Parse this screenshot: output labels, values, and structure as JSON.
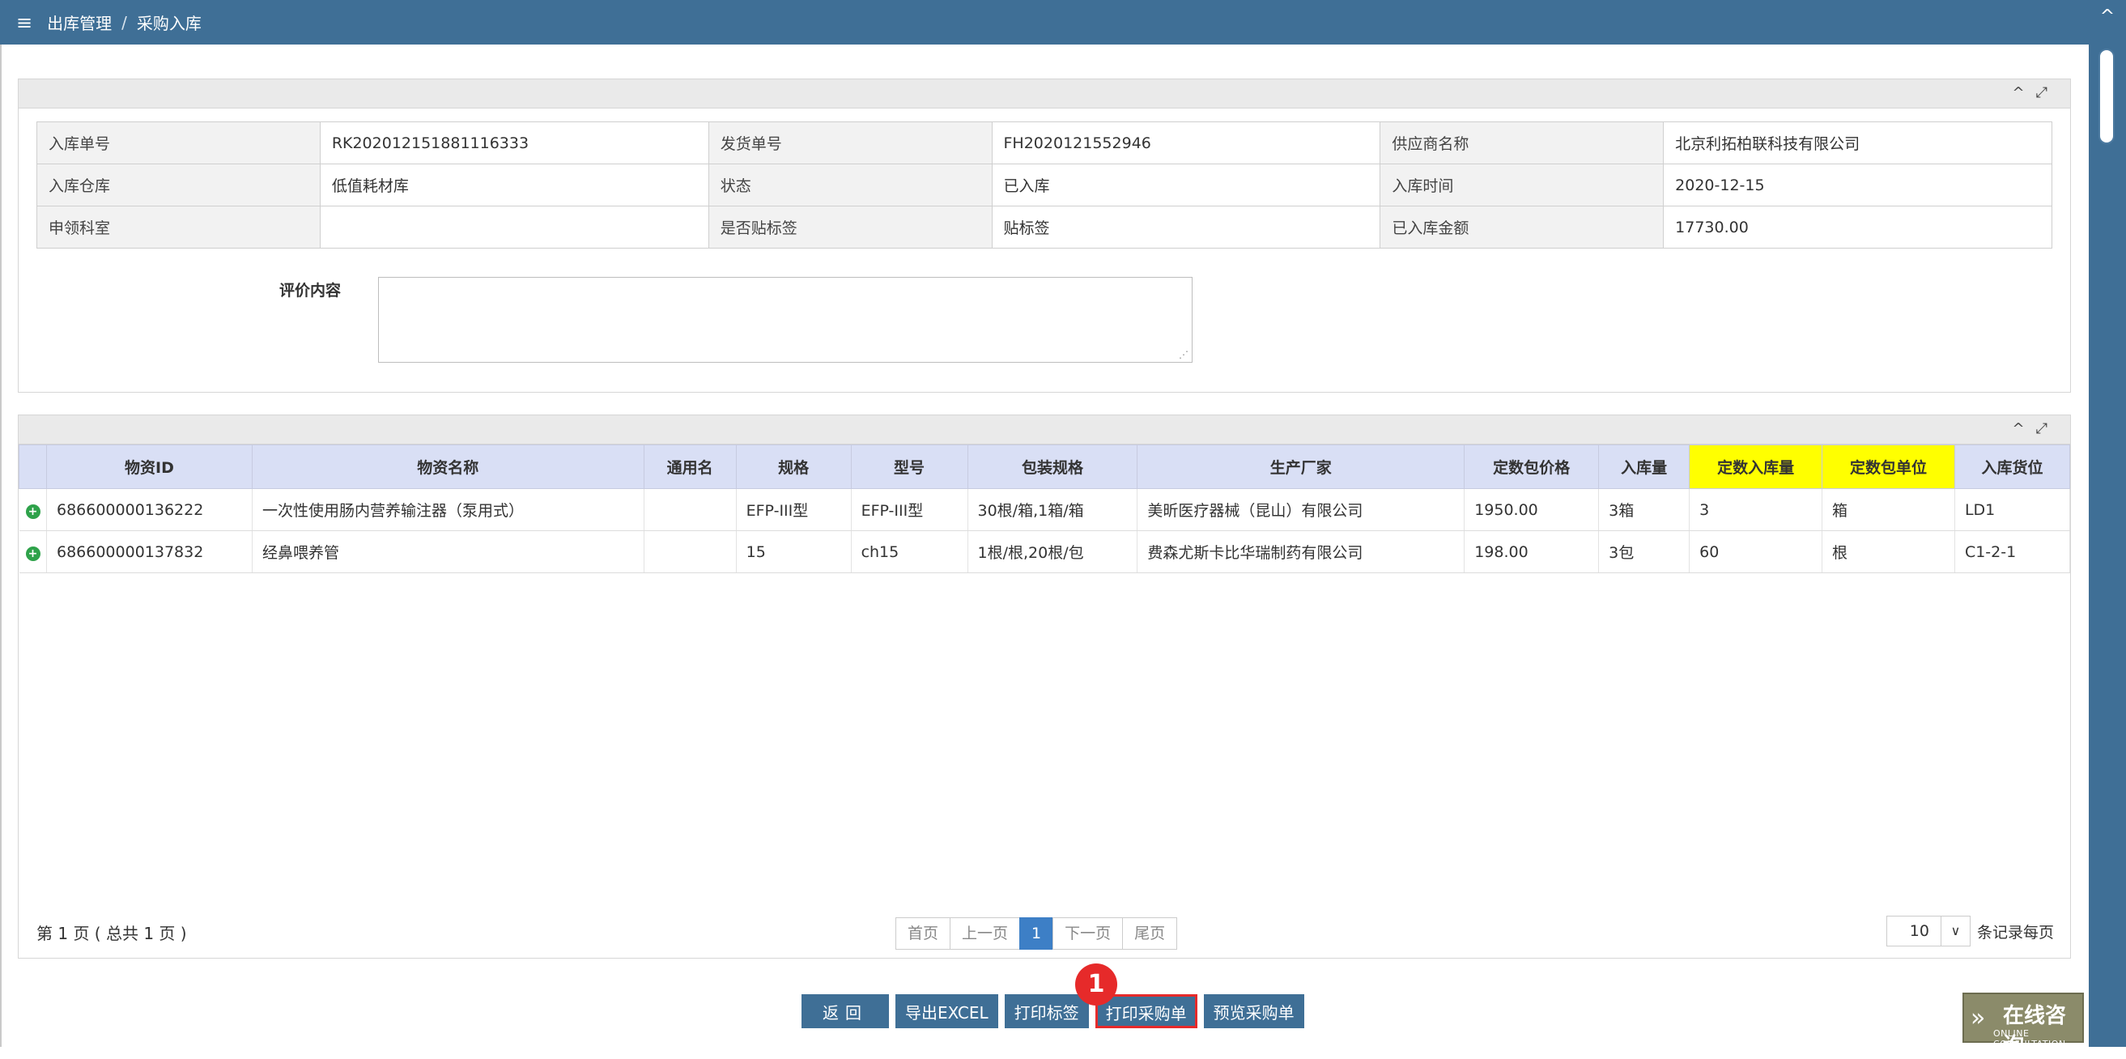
{
  "topbar": {
    "menu_icon": "≡",
    "breadcrumb_parent": "出库管理",
    "breadcrumb_sep": "/",
    "breadcrumb_current": "采购入库"
  },
  "panel_tools": {
    "collapse": "^",
    "expand": "⤢"
  },
  "info": {
    "rows": [
      [
        {
          "label": "入库单号",
          "value": "RK202012151881116333"
        },
        {
          "label": "发货单号",
          "value": "FH2020121552946"
        },
        {
          "label": "供应商名称",
          "value": "北京利拓柏联科技有限公司"
        }
      ],
      [
        {
          "label": "入库仓库",
          "value": "低值耗材库"
        },
        {
          "label": "状态",
          "value": "已入库"
        },
        {
          "label": "入库时间",
          "value": "2020-12-15"
        }
      ],
      [
        {
          "label": "申领科室",
          "value": ""
        },
        {
          "label": "是否贴标签",
          "value": "贴标签"
        },
        {
          "label": "已入库金额",
          "value": "17730.00"
        }
      ]
    ],
    "eval_label": "评价内容",
    "eval_value": ""
  },
  "grid": {
    "headers": [
      "物资ID",
      "物资名称",
      "通用名",
      "规格",
      "型号",
      "包装规格",
      "生产厂家",
      "定数包价格",
      "入库量",
      "定数入库量",
      "定数包单位",
      "入库货位"
    ],
    "highlight_headers": [
      "定数入库量",
      "定数包单位"
    ],
    "rows": [
      [
        "686600000136222",
        "一次性使用肠内营养输注器（泵用式）",
        "",
        "EFP-III型",
        "EFP-III型",
        "30根/箱,1箱/箱",
        "美昕医疗器械（昆山）有限公司",
        "1950.00",
        "3箱",
        "3",
        "箱",
        "LD1"
      ],
      [
        "686600000137832",
        "经鼻喂养管",
        "",
        "15",
        "ch15",
        "1根/根,20根/包",
        "费森尤斯卡比华瑞制药有限公司",
        "198.00",
        "3包",
        "60",
        "根",
        "C1-2-1"
      ]
    ]
  },
  "pagination": {
    "info": "第 1 页 ( 总共 1 页 )",
    "first": "首页",
    "prev": "上一页",
    "current": "1",
    "next": "下一页",
    "last": "尾页",
    "per_page_value": "10",
    "per_page_label": "条记录每页"
  },
  "actions": {
    "back": "返回",
    "export": "导出EXCEL",
    "print_label": "打印标签",
    "print_order": "打印采购单",
    "preview_order": "预览采购单"
  },
  "marker": "1",
  "consult": {
    "title": "在线咨询",
    "subtitle": "ONLINE CONSULTATION"
  },
  "colors": {
    "header_blue": "#3f6f96",
    "grid_header": "#d9dff5",
    "highlight": "#ffff00",
    "marker_red": "#e62a2a"
  }
}
